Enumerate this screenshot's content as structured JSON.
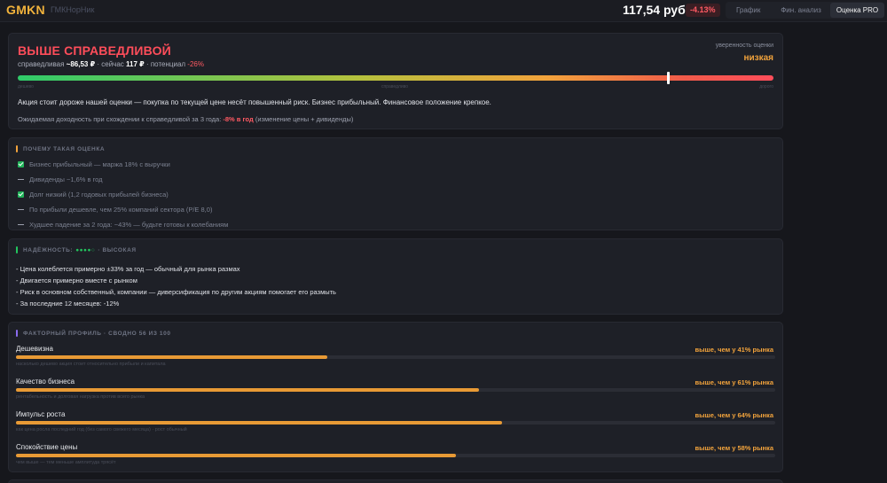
{
  "header": {
    "ticker": "GMKN",
    "company": "ГМКНорНик",
    "price": "117,54 руб",
    "change": "-4.13%",
    "tabs": [
      {
        "label": "График"
      },
      {
        "label": "Фин. анализ"
      },
      {
        "label": "Оценка PRO"
      }
    ],
    "active_tab": 2
  },
  "valuation": {
    "verdict": "ВЫШЕ СПРАВЕДЛИВОЙ",
    "fair_label": "справедливая",
    "fair_value": "~86,53 ₽",
    "now_label": "сейчас",
    "now_value": "117 ₽",
    "potential_label": "потенциал",
    "potential_value": "-26%",
    "confidence_label": "уверенность оценки",
    "confidence_value": "низкая",
    "scale_labels": [
      "дешево",
      "справедливо",
      "дорого"
    ],
    "marker_fraction": 0.86,
    "summary": "Акция стоит дороже нашей оценки — покупка по текущей цене несёт повышенный риск. Бизнес прибыльный. Финансовое положение крепкое.",
    "yield_prefix": "Ожидаемая доходность при схождении к справедливой за 3 года:",
    "yield_value": "-8% в год",
    "yield_suffix": "(изменение цены + дивиденды)"
  },
  "reasons": {
    "title": "ПОЧЕМУ ТАКАЯ ОЦЕНКА",
    "items": [
      {
        "text": "Бизнес прибыльный — маржа 18% с выручки",
        "positive": true
      },
      {
        "text": "Дивиденды ~1,6% в год",
        "positive": false
      },
      {
        "text": "Долг низкий (1,2 годовых прибылей бизнеса)",
        "positive": true
      },
      {
        "text": "По прибыли дешевле, чем 25% компаний сектора (P/E 8,0)",
        "positive": false
      },
      {
        "text": "Худшее падение за 2 года: −43% — будьте готовы к колебаниям",
        "positive": false
      }
    ]
  },
  "reliability": {
    "title": "НАДЁЖНОСТЬ:",
    "dots": "●●●●○",
    "level": "· ВЫСОКАЯ",
    "lines": [
      "- Цена колеблется примерно ±33% за год — обычный для рынка размах",
      "- Двигается примерно вместе с рынком",
      "- Риск в основном собственный, компании — диверсификация по другим акциям помогает его размыть",
      "- За последние 12 месяцев: -12%"
    ]
  },
  "factors": {
    "title": "ФАКТОРНЫЙ ПРОФИЛЬ · СВОДНО 56 ИЗ 100",
    "items": [
      {
        "name": "Дешевизна",
        "value_text": "выше, чем у 41% рынка",
        "fill": 0.41,
        "desc": "насколько дешево акция стоит относительно прибыли и капитала"
      },
      {
        "name": "Качество бизнеса",
        "value_text": "выше, чем у 61% рынка",
        "fill": 0.61,
        "desc": "рентабельность и долговая нагрузка против всего рынка"
      },
      {
        "name": "Импульс роста",
        "value_text": "выше, чем у 64% рынка",
        "fill": 0.64,
        "desc": "как цена росла последний год (без самого свежего месяца) · рост обычный"
      },
      {
        "name": "Спокойствие цены",
        "value_text": "выше, чем у 58% рынка",
        "fill": 0.58,
        "desc": "чем выше — тем меньше амплитуда трясёт"
      }
    ]
  },
  "colors": {
    "accent": "#f2a33c",
    "negative": "#ff4d5a",
    "positive": "#22c55e"
  }
}
